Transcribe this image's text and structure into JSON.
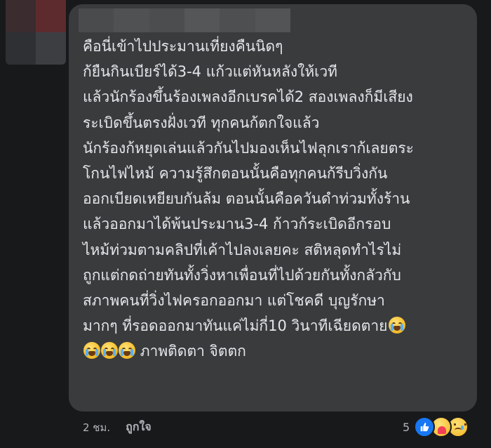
{
  "comment": {
    "lines": [
      "คือนี่เข้าไปประมานเที่ยงคืนนิดๆ",
      "ก้ยืนกินเบียร์ได้3-4 แก้วแต่หันหลังให้เวที",
      "แล้วนักร้องขึ้นร้องเพลงอีกเบรคได้2 สองเพลงก็มีเสียง",
      "ระเบิดขึ้นตรงฝั่งเวที ทุกคนก้ตกใจแล้ว",
      "นักร้องก้หยุดเล่นแล้วกันไปมองเห็นไฟลุกเราก้เลยตระ",
      "โกนไฟไหม้ ความรู้สึกตอนนั้นคือทุกคนก้รีบวิ่งกัน",
      "ออกเบียดเหยียบกันล้ม ตอนนั้นคือควันดำท่วมทั้งร้าน",
      "แล้วออกมาได้พ้นประมาน3-4 ก้าวก้ระเบิดอีกรอบ",
      "ไหม้ท่วมตามคลิปที่เค้าไปลงเลยคะ สติหลุดทำไรไม่",
      "ถูกแต่กดถ่ายทันทั้งวิ่งหาเพื่อนที่ไปด้วยกันทั้งกลัวกับ",
      "สภาพคนที่วิ่งไฟครอกออกมา แต่โชคดี บุญรักษา",
      "มากๆ ที่รอดออกมาทันแค่ไม่กี่10 วินาทีเฉียดตาย",
      "ภาพติดตา จิตตก"
    ],
    "emoji_icons": [
      "loudly-crying-face-icon"
    ]
  },
  "meta": {
    "timestamp": "2 ชม.",
    "like_link": "ถูกใจ"
  },
  "reactions": {
    "count": "5",
    "types": [
      "like-icon",
      "care-icon",
      "sad-icon"
    ]
  },
  "colors": {
    "background": "#18191a",
    "bubble": "#3a3b3c",
    "text": "#e4e6eb",
    "meta_text": "#b0b3b8",
    "like_blue": "#1877f2"
  }
}
